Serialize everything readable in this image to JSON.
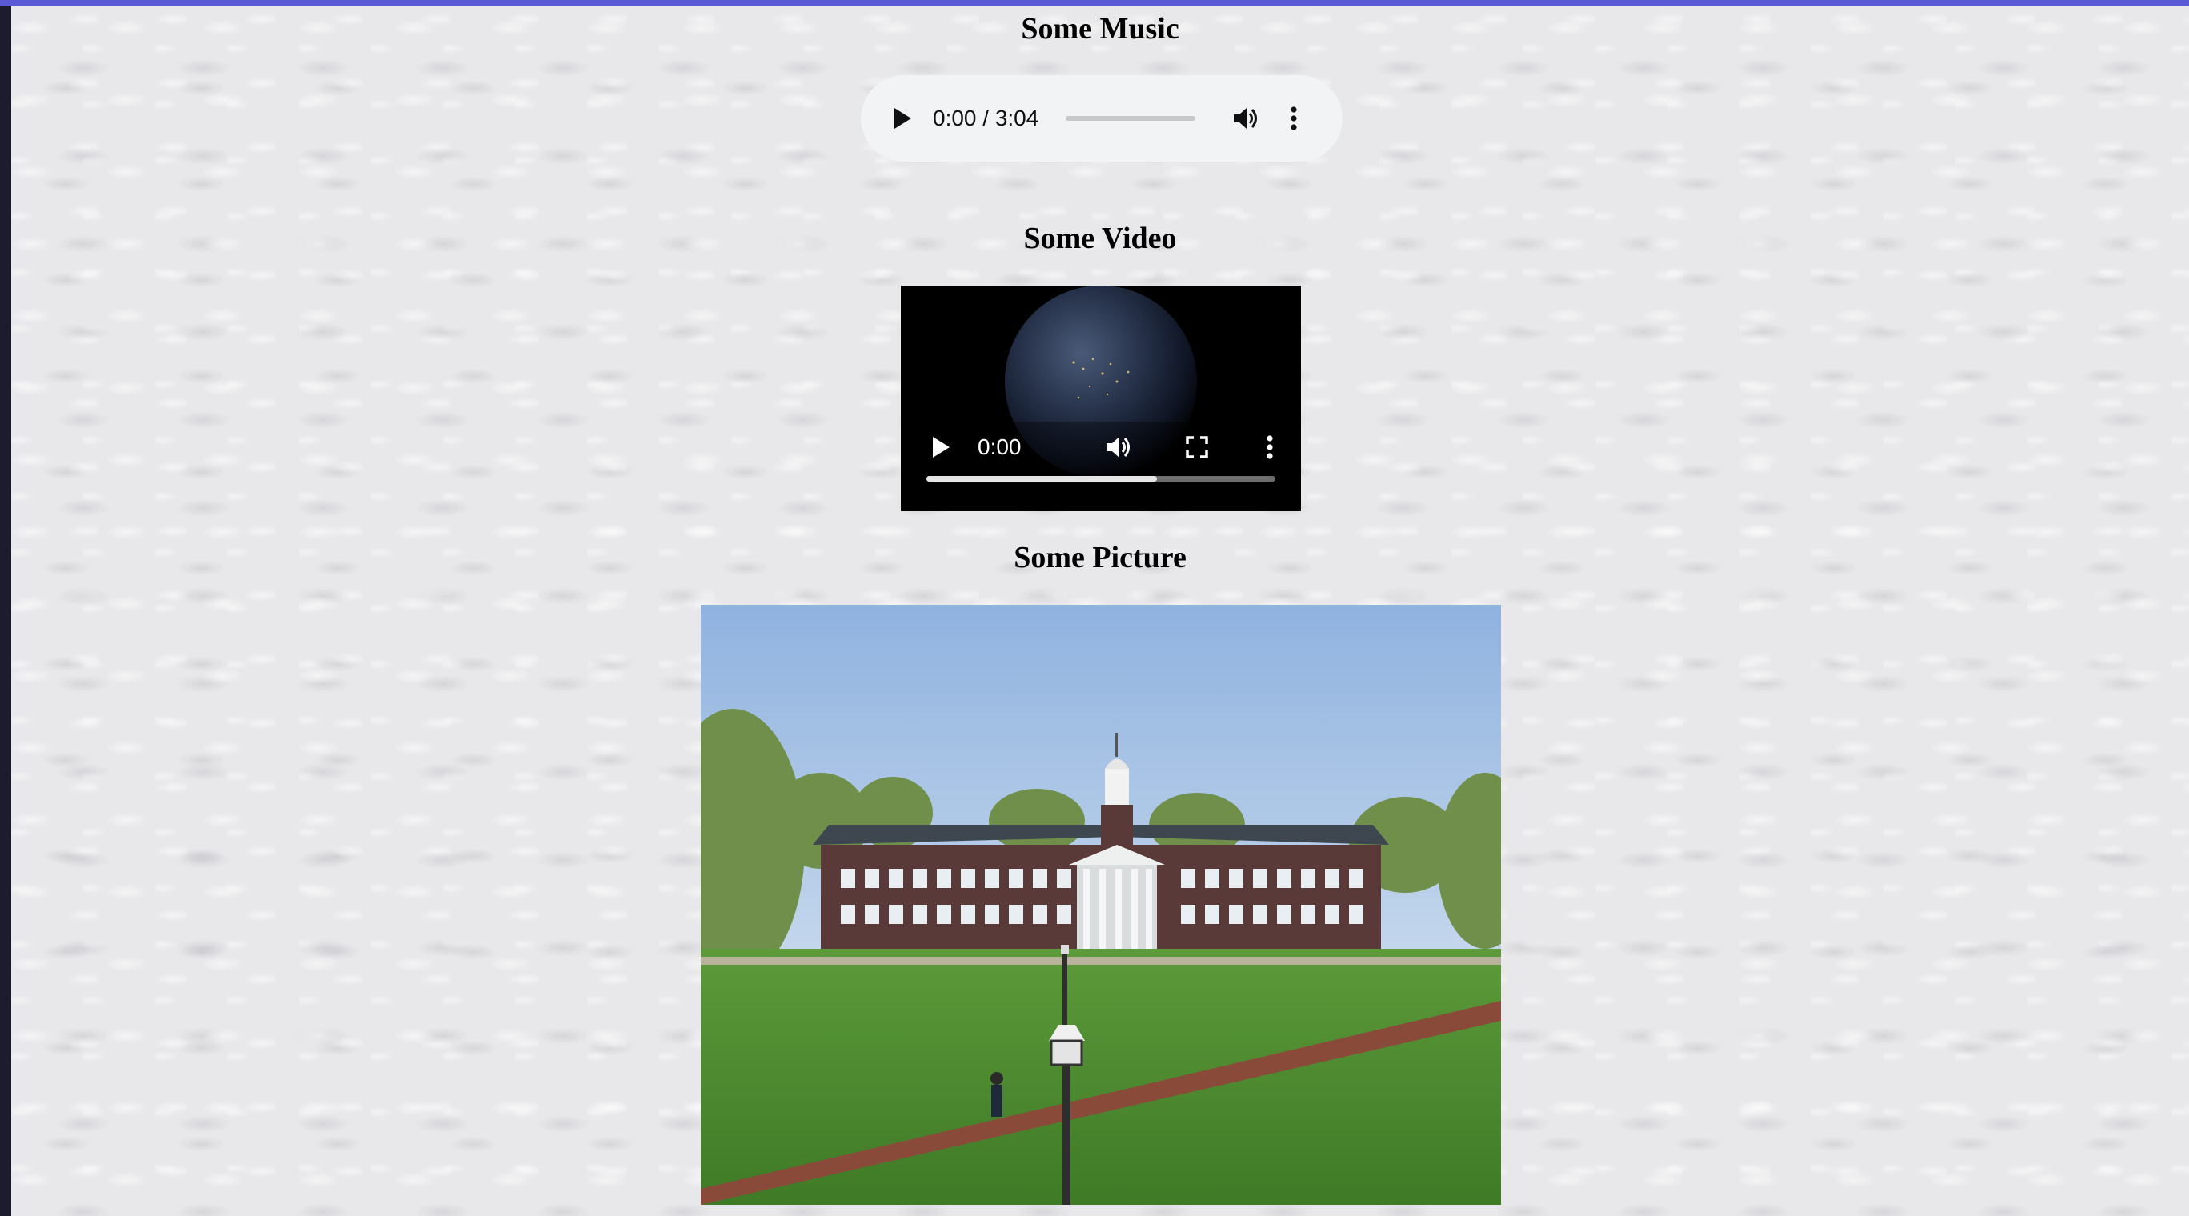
{
  "music": {
    "heading": "Some Music",
    "time": "0:00 / 3:04",
    "progress": 0
  },
  "video": {
    "heading": "Some Video",
    "time": "0:00",
    "buffered": 0.66
  },
  "picture": {
    "heading": "Some Picture"
  },
  "colors": {
    "accent": "#5a5ad6",
    "page_bg": "#e8e8ea",
    "audio_bg": "#f1f3f4"
  },
  "icons": {
    "audio_play": "play-icon",
    "audio_volume": "volume-icon",
    "audio_more": "more-vertical-icon",
    "video_play": "play-icon",
    "video_volume": "volume-icon",
    "video_fullscreen": "fullscreen-icon",
    "video_more": "more-vertical-icon"
  }
}
